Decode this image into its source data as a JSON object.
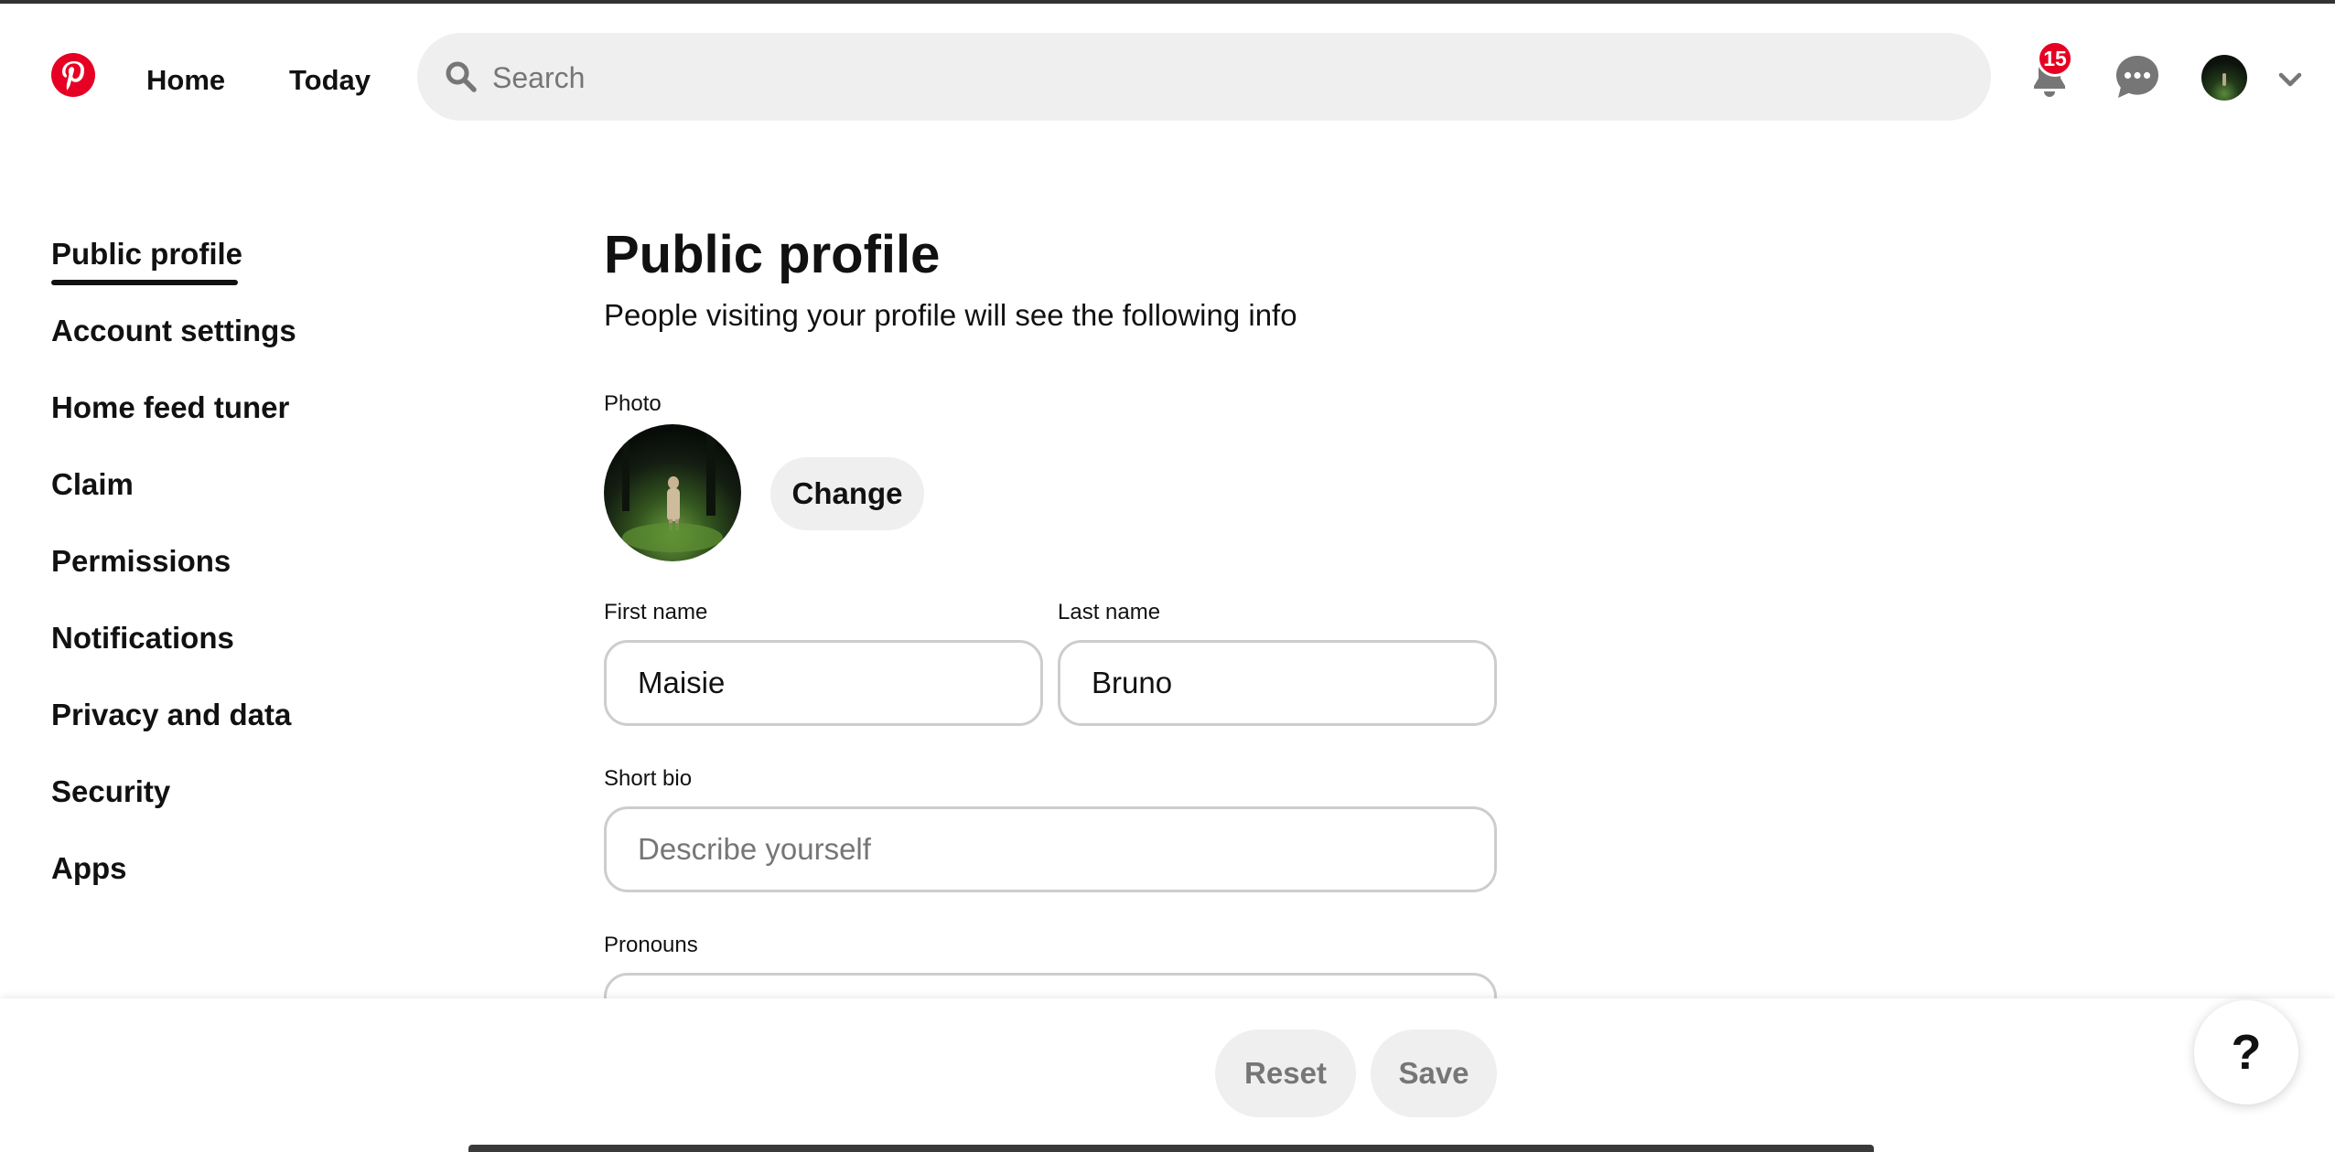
{
  "header": {
    "nav": [
      {
        "label": "Home"
      },
      {
        "label": "Today"
      }
    ],
    "search": {
      "placeholder": "Search",
      "value": ""
    },
    "notifications_count": "15",
    "brand_color": "#e60023",
    "icons": [
      "pinterest-logo",
      "search-icon",
      "bell-icon",
      "chat-icon",
      "avatar",
      "chevron-down-icon"
    ]
  },
  "sidebar": {
    "active": "Public profile",
    "items": [
      {
        "label": "Public profile"
      },
      {
        "label": "Account settings"
      },
      {
        "label": "Home feed tuner"
      },
      {
        "label": "Claim"
      },
      {
        "label": "Permissions"
      },
      {
        "label": "Notifications"
      },
      {
        "label": "Privacy and data"
      },
      {
        "label": "Security"
      },
      {
        "label": "Apps"
      }
    ]
  },
  "main": {
    "title": "Public profile",
    "subtitle": "People visiting your profile will see the following info",
    "photo_label": "Photo",
    "change_label": "Change",
    "first_name": {
      "label": "First name",
      "value": "Maisie"
    },
    "last_name": {
      "label": "Last name",
      "value": "Bruno"
    },
    "short_bio": {
      "label": "Short bio",
      "placeholder": "Describe yourself",
      "value": ""
    },
    "pronouns": {
      "label": "Pronouns"
    }
  },
  "footer": {
    "reset_label": "Reset",
    "save_label": "Save",
    "help_label": "?"
  }
}
